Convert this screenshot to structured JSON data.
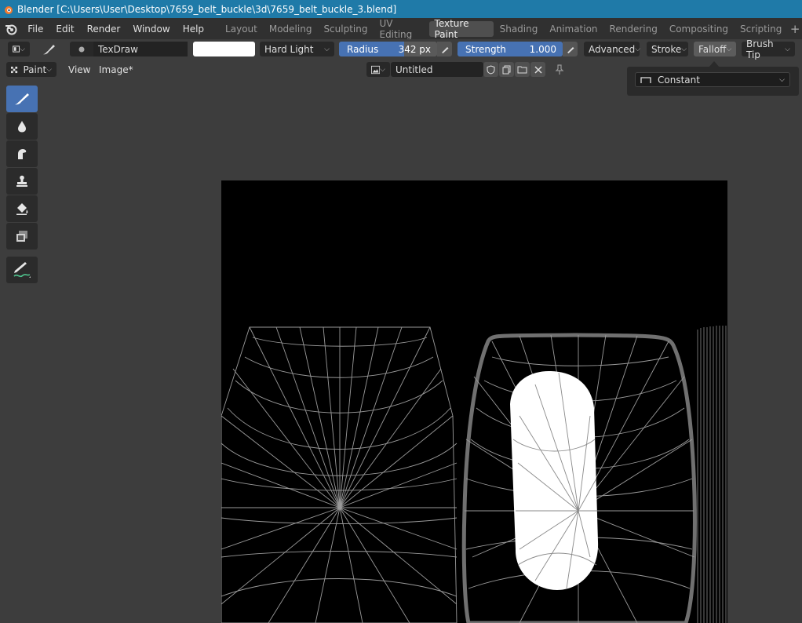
{
  "window_title": "Blender [C:\\Users\\User\\Desktop\\7659_belt_buckle\\3d\\7659_belt_buckle_3.blend]",
  "menu": [
    "File",
    "Edit",
    "Render",
    "Window",
    "Help"
  ],
  "workspaces": [
    "Layout",
    "Modeling",
    "Sculpting",
    "UV Editing",
    "Texture Paint",
    "Shading",
    "Animation",
    "Rendering",
    "Compositing",
    "Scripting"
  ],
  "active_workspace": "Texture Paint",
  "tool_header": {
    "brush_name": "TexDraw",
    "blend_mode": "Hard Light",
    "radius_label": "Radius",
    "radius_value": "342 px",
    "strength_label": "Strength",
    "strength_value": "1.000",
    "strength_fill": 1.0,
    "advanced": "Advanced",
    "stroke": "Stroke",
    "falloff": "Falloff",
    "brush_tip": "Brush Tip"
  },
  "sub_header": {
    "mode": "Paint",
    "view": "View",
    "image_menu": "Image*",
    "image_name": "Untitled"
  },
  "falloff_popover": {
    "value": "Constant"
  },
  "colors": {
    "accent": "#4772b3",
    "titlebar": "#1f7aa8",
    "mesh_wire": "#9a9a9a"
  }
}
